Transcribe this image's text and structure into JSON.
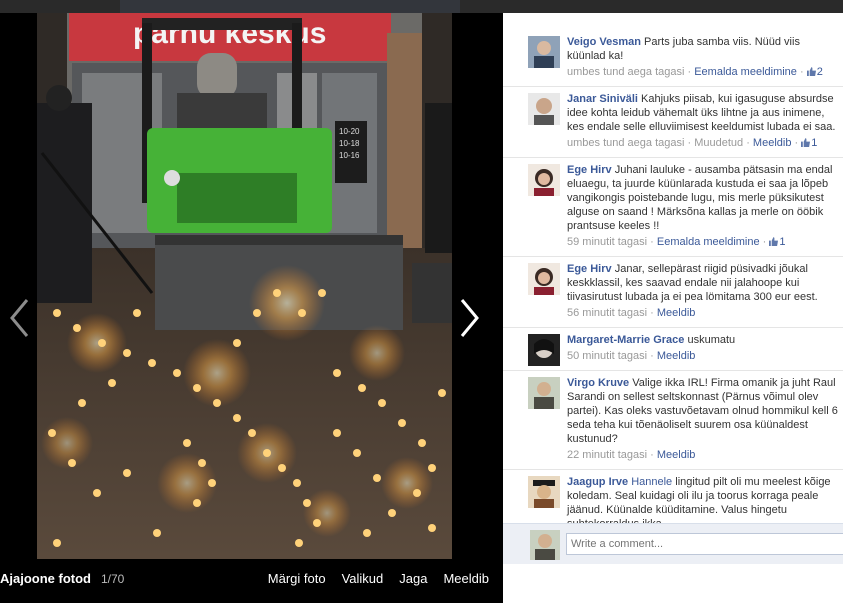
{
  "viewer": {
    "album_label": "Ajajoone fotod",
    "counter": "1/70",
    "actions": [
      "Märgi foto",
      "Valikud",
      "Jaga",
      "Meeldib"
    ],
    "photo_sign": "pärnu keskus",
    "door_hours": [
      "10-20",
      "10-18",
      "10-16"
    ]
  },
  "comments": [
    {
      "author": "Veigo Vesman",
      "text": "Parts juba samba viis. Nüüd viis küünlad ka!",
      "time": "umbes tund aega tagasi",
      "action": "Eemalda meeldimine",
      "likes": "2"
    },
    {
      "author": "Janar Siniväli",
      "text": "Kahjuks piisab, kui igasuguse absurdse idee kohta leidub vähemalt üks lihtne ja aus inimene, kes endale selle elluviimisest keeldumist lubada ei saa.",
      "time": "umbes tund aega tagasi",
      "edited": "Muudetud",
      "action": "Meeldib",
      "likes": "1"
    },
    {
      "author": "Ege Hirv",
      "text": "Juhani lauluke - ausamba pätsasin ma endal eluaegu, ta juurde küünlarada kustuda ei saa ja lõpeb vangikongis poistebande lugu, mis merle püksikutest alguse on saand ! Märksõna kallas ja merle on ööbik prantsuse keeles !!",
      "time": "59 minutit tagasi",
      "action": "Eemalda meeldimine",
      "likes": "1"
    },
    {
      "author": "Ege Hirv",
      "text": "Janar, sellepärast riigid püsivadki jõukal keskklassil, kes saavad endale nii jalahoope kui tiivasirutust lubada ja ei pea lömitama 300 eur eest.",
      "time": "56 minutit tagasi",
      "action": "Meeldib"
    },
    {
      "author": "Margaret-Marrie Grace",
      "text": "uskumatu",
      "time": "50 minutit tagasi",
      "action": "Meeldib"
    },
    {
      "author": "Virgo Kruve",
      "text": "Valige ikka IRL! Firma omanik ja juht Raul Sarandi on sellest seltskonnast (Pärnus võimul olev partei). Kas oleks vastuvõetavam olnud hommikul kell 6 seda teha kui tõenäoliselt suurem osa küünaldest kustunud?",
      "time": "22 minutit tagasi",
      "action": "Meeldib"
    },
    {
      "author": "Jaagup Irve",
      "tag": "Hannele",
      "text": "lingitud pilt oli mu meelest kõige koledam. Seal kuidagi oli ilu ja toorus korraga peale jäänud. Küünalde küüditamine. Valus hingetu suhtekorraldus ikka"
    }
  ],
  "composer": {
    "placeholder": "Write a comment..."
  },
  "colors": {
    "link": "#3b5998",
    "meta": "#999999",
    "panel": "#ffffff",
    "viewer": "#000000"
  }
}
